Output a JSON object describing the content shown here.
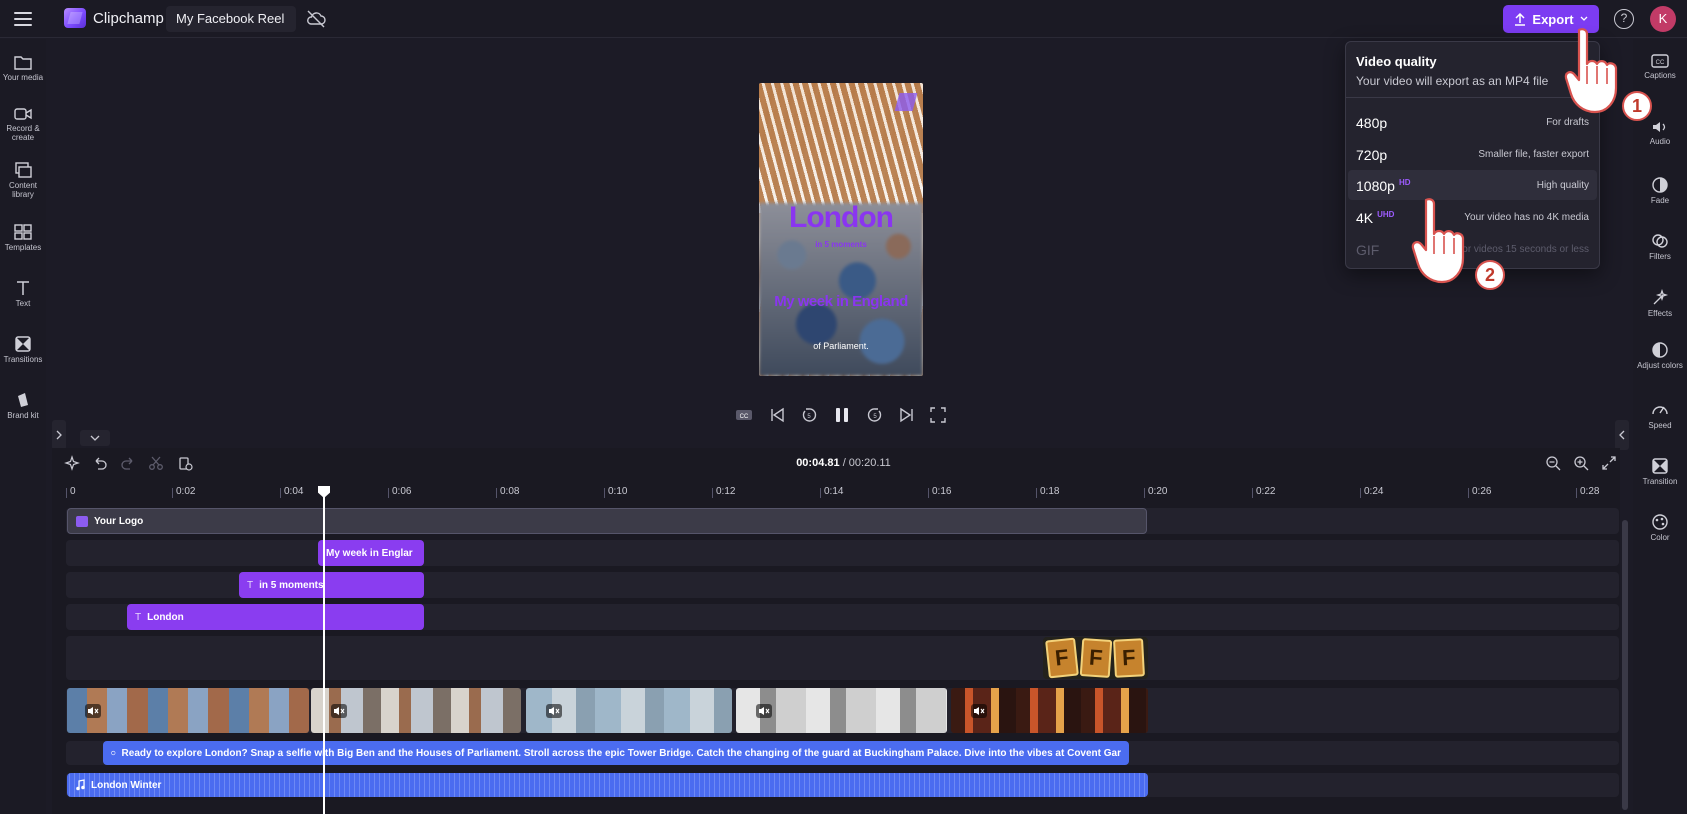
{
  "app": {
    "name": "Clipchamp",
    "project_title": "My Facebook Reel",
    "export_label": "Export",
    "help_label": "?",
    "avatar_initial": "K"
  },
  "left_sidebar": [
    {
      "label": "Your media",
      "icon": "folder-icon"
    },
    {
      "label": "Record & create",
      "icon": "camera-icon"
    },
    {
      "label": "Content library",
      "icon": "library-icon"
    },
    {
      "label": "Templates",
      "icon": "templates-icon"
    },
    {
      "label": "Text",
      "icon": "text-icon"
    },
    {
      "label": "Transitions",
      "icon": "transitions-icon"
    },
    {
      "label": "Brand kit",
      "icon": "brand-kit-icon"
    }
  ],
  "right_sidebar": [
    {
      "label": "Captions",
      "icon": "captions-icon"
    },
    {
      "label": "Audio",
      "icon": "audio-icon"
    },
    {
      "label": "Fade",
      "icon": "fade-icon"
    },
    {
      "label": "Filters",
      "icon": "filters-icon"
    },
    {
      "label": "Effects",
      "icon": "effects-icon"
    },
    {
      "label": "Adjust colors",
      "icon": "adjust-colors-icon"
    },
    {
      "label": "Speed",
      "icon": "speed-icon"
    },
    {
      "label": "Transition",
      "icon": "transition-icon"
    },
    {
      "label": "Color",
      "icon": "color-icon"
    }
  ],
  "preview": {
    "title": "London",
    "subtitle": "in 5 moments",
    "tagline": "My week in England",
    "caption": "of Parliament."
  },
  "export_menu": {
    "title": "Video quality",
    "subtitle": "Your video will export as an MP4 file",
    "options": [
      {
        "res": "480p",
        "badge": "",
        "desc": "For drafts",
        "state": "normal"
      },
      {
        "res": "720p",
        "badge": "",
        "desc": "Smaller file, faster export",
        "state": "normal"
      },
      {
        "res": "1080p",
        "badge": "HD",
        "desc": "High quality",
        "state": "selected"
      },
      {
        "res": "4K",
        "badge": "UHD",
        "desc": "Your video has no 4K media",
        "state": "normal"
      },
      {
        "res": "GIF",
        "badge": "",
        "desc": "For videos 15 seconds or less",
        "state": "disabled"
      }
    ]
  },
  "steps": [
    "1",
    "2"
  ],
  "timeline": {
    "current_time": "00:04.81",
    "total_time": "/ 00:20.11",
    "ruler": [
      "0",
      "0:02",
      "0:04",
      "0:06",
      "0:08",
      "0:10",
      "0:12",
      "0:14",
      "0:16",
      "0:18",
      "0:20",
      "0:22",
      "0:24",
      "0:26",
      "0:28"
    ],
    "clips": {
      "logo": "Your Logo",
      "text_week": "My week in Englar",
      "text_moments": "in 5 moments",
      "text_london": "London",
      "caption": "Ready to explore London? Snap a selfie with Big Ben and the Houses of Parliament. Stroll across the epic Tower Bridge. Catch the changing of the guard at Buckingham Palace. Dive into the vibes at Covent Gar",
      "audio": "London Winter",
      "sticker_letter": "F"
    }
  },
  "colors": {
    "accent": "#7c3cf2",
    "text_clip": "#8a3df0",
    "caption_clip": "#4b6cf0",
    "step_badge": "#d8534f"
  }
}
